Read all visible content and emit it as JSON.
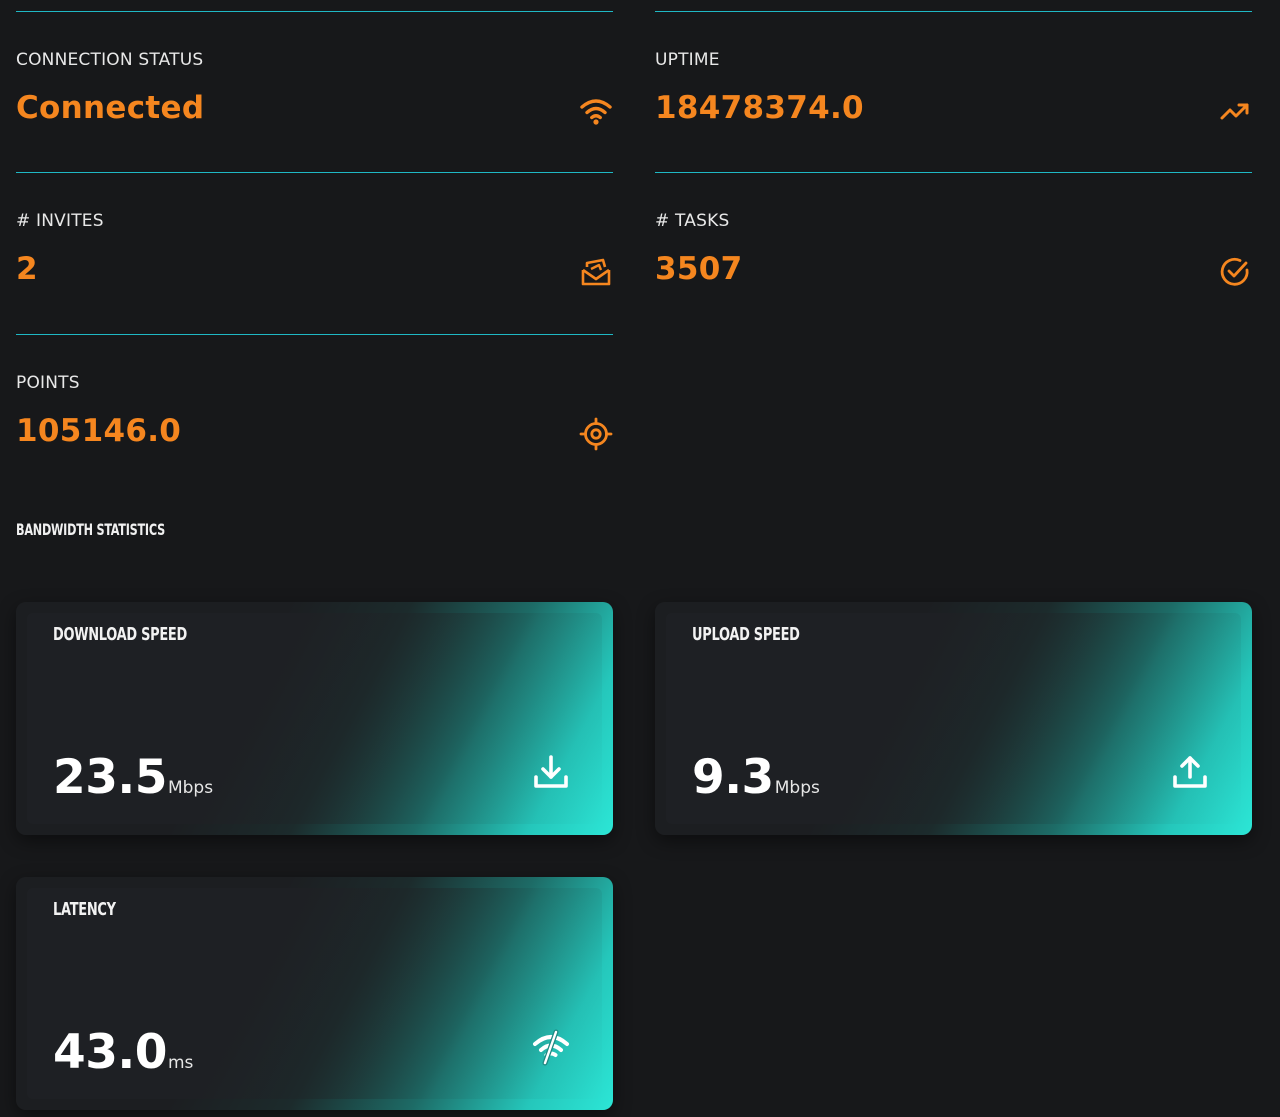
{
  "stats": {
    "connection": {
      "label": "CONNECTION STATUS",
      "value": "Connected",
      "icon": "wifi-icon"
    },
    "uptime": {
      "label": "UPTIME",
      "value": "18478374.0",
      "icon": "trending-up-icon"
    },
    "invites": {
      "label": "# INVITES",
      "value": "2",
      "icon": "invites-stack-icon"
    },
    "tasks": {
      "label": "# TASKS",
      "value": "3507",
      "icon": "check-circle-icon"
    },
    "points": {
      "label": "POINTS",
      "value": "105146.0",
      "icon": "target-icon"
    }
  },
  "bandwidth": {
    "title": "BANDWIDTH STATISTICS",
    "download": {
      "label": "DOWNLOAD SPEED",
      "value": "23.5",
      "unit": "Mbps",
      "icon": "download-icon"
    },
    "upload": {
      "label": "UPLOAD SPEED",
      "value": "9.3",
      "unit": "Mbps",
      "icon": "upload-icon"
    },
    "latency": {
      "label": "LATENCY",
      "value": "43.0",
      "unit": "ms",
      "icon": "signal-broken-icon"
    }
  },
  "colors": {
    "accent": "#f5861f",
    "divider": "#1fb8c4",
    "background": "#17181a",
    "card_glow": "#2ce6d6"
  }
}
